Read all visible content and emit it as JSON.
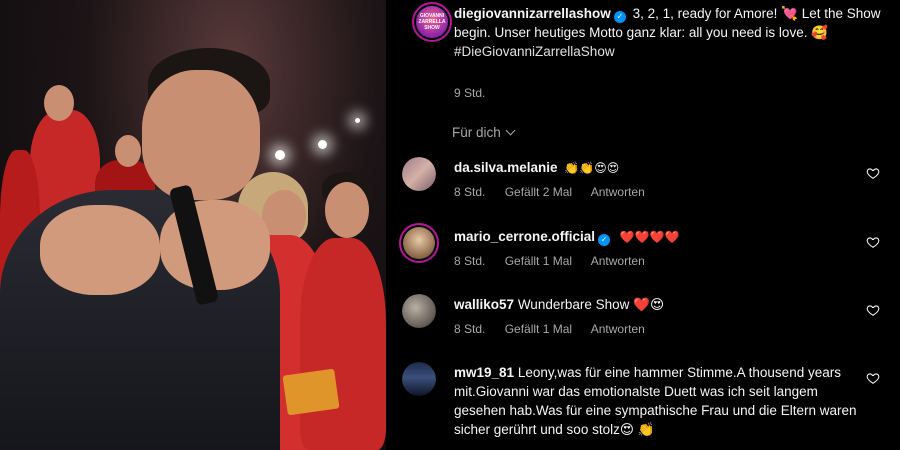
{
  "post": {
    "username": "diegiovannizarrellashow",
    "caption": "3, 2, 1, ready for Amore! 💘 Let the Show begin. Unser heutiges Motto ganz klar: all you need is love. 🥰",
    "hashtag": "#DieGiovanniZarrellaShow",
    "time": "9 Std.",
    "logo_text": "GIOVANNI ZARRELLA SHOW"
  },
  "filter": {
    "label": "Für dich"
  },
  "comments": [
    {
      "username": "da.silva.melanie",
      "text": "👏👏😍😍",
      "time": "8 Std.",
      "likes": "Gefällt 2 Mal",
      "reply": "Antworten"
    },
    {
      "username": "mario_cerrone.official",
      "text": "❤️❤️❤️❤️",
      "time": "8 Std.",
      "likes": "Gefällt 1 Mal",
      "reply": "Antworten"
    },
    {
      "username": "walliko57",
      "text": "Wunderbare Show ❤️😍",
      "time": "8 Std.",
      "likes": "Gefällt 1 Mal",
      "reply": "Antworten"
    },
    {
      "username": "mw19_81",
      "text": "Leony,was für eine hammer Stimme.A thousend years mit.Giovanni war das emotionalste Duett was ich seit langem gesehen hab.Was für eine sympathische Frau und die Eltern waren sicher gerührt und soo stolz😍 👏"
    }
  ],
  "colors": {
    "background": "#000000",
    "secondary_text": "#a8a8a8",
    "verified": "#0095f6",
    "story_ring": "#b5179e"
  },
  "icons": [
    "verified-badge-icon",
    "chevron-down-icon",
    "heart-outline-icon"
  ]
}
